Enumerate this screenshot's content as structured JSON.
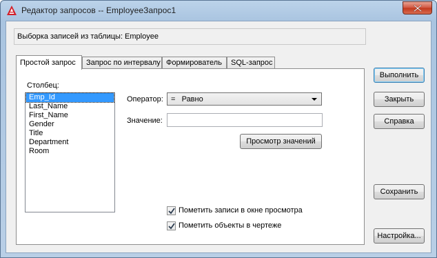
{
  "window": {
    "title": "Редактор запросов -- EmployeeЗапрос1"
  },
  "source": {
    "text": "Выборка записей из таблицы:  Employee"
  },
  "tabs": [
    {
      "label": "Простой запрос",
      "active": true
    },
    {
      "label": "Запрос по интервалу",
      "active": false
    },
    {
      "label": "Формирователь",
      "active": false
    },
    {
      "label": "SQL-запрос",
      "active": false
    }
  ],
  "simple_query": {
    "column_label": "Столбец:",
    "columns": [
      "Emp_Id",
      "Last_Name",
      "First_Name",
      "Gender",
      "Title",
      "Department",
      "Room"
    ],
    "selected_column": "Emp_Id",
    "operator_label": "Оператор:",
    "operator_value": "=   Равно",
    "value_label": "Значение:",
    "value_input": "",
    "browse_values_button": "Просмотр значений",
    "highlight_in_view_checkbox": {
      "label": "Пометить записи в окне просмотра",
      "checked": true
    },
    "mark_objects_checkbox": {
      "label": "Пометить объекты в чертеже",
      "checked": true
    }
  },
  "buttons": {
    "execute": "Выполнить",
    "close": "Закрыть",
    "help": "Справка",
    "save": "Сохранить",
    "settings": "Настройка..."
  },
  "colors": {
    "selection": "#3399ff",
    "title_bar": "#a9c4e0",
    "close_button": "#c1381d"
  }
}
